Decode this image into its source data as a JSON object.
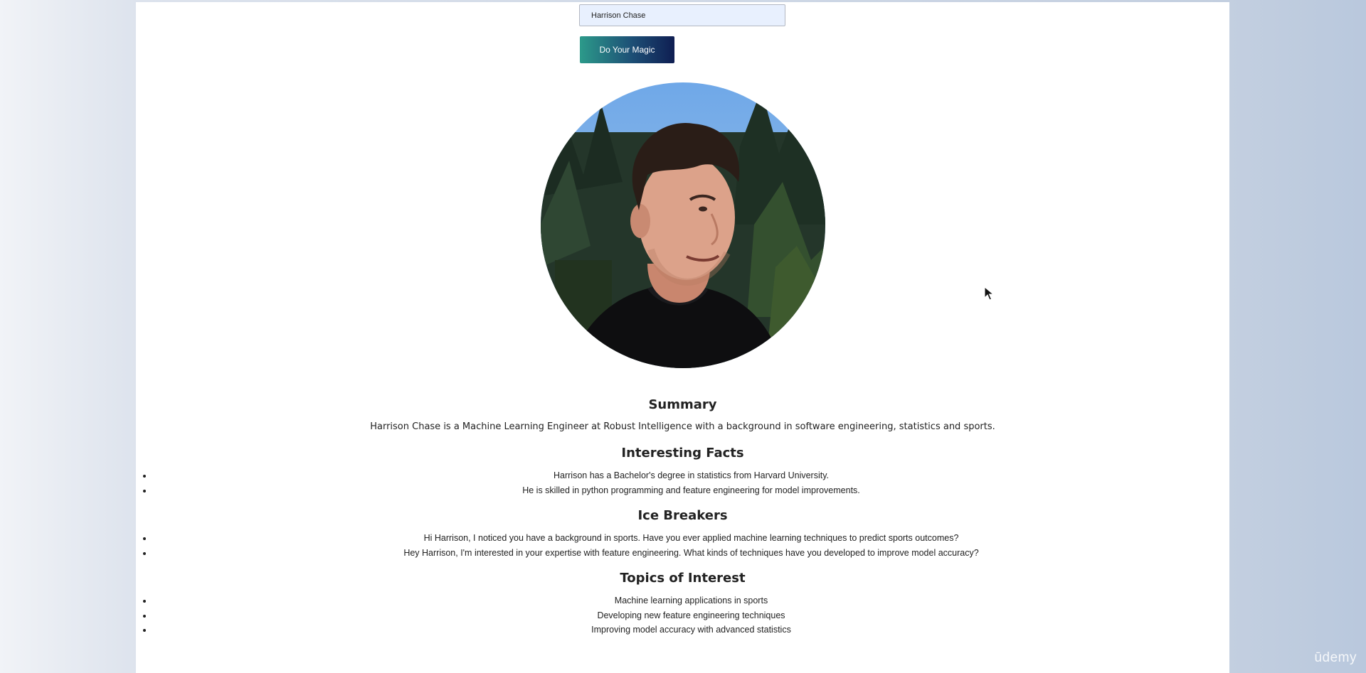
{
  "form": {
    "name_value": "Harrison Chase",
    "submit_label": "Do Your Magic"
  },
  "profile": {
    "avatar_description": "profile-photo"
  },
  "summary": {
    "heading": "Summary",
    "text": "Harrison Chase is a Machine Learning Engineer at Robust Intelligence with a background in software engineering, statistics and sports."
  },
  "facts": {
    "heading": "Interesting Facts",
    "items": [
      "Harrison has a Bachelor's degree in statistics from Harvard University.",
      "He is skilled in python programming and feature engineering for model improvements."
    ]
  },
  "ice_breakers": {
    "heading": "Ice Breakers",
    "items": [
      "Hi Harrison, I noticed you have a background in sports. Have you ever applied machine learning techniques to predict sports outcomes?",
      "Hey Harrison, I'm interested in your expertise with feature engineering. What kinds of techniques have you developed to improve model accuracy?"
    ]
  },
  "topics": {
    "heading": "Topics of Interest",
    "items": [
      "Machine learning applications in sports",
      "Developing new feature engineering techniques",
      "Improving model accuracy with advanced statistics"
    ]
  },
  "watermark": {
    "text": "ūdemy"
  },
  "colors": {
    "button_gradient_start": "#2c9a8a",
    "button_gradient_end": "#0f1e52",
    "input_background": "#e8f0fe"
  }
}
